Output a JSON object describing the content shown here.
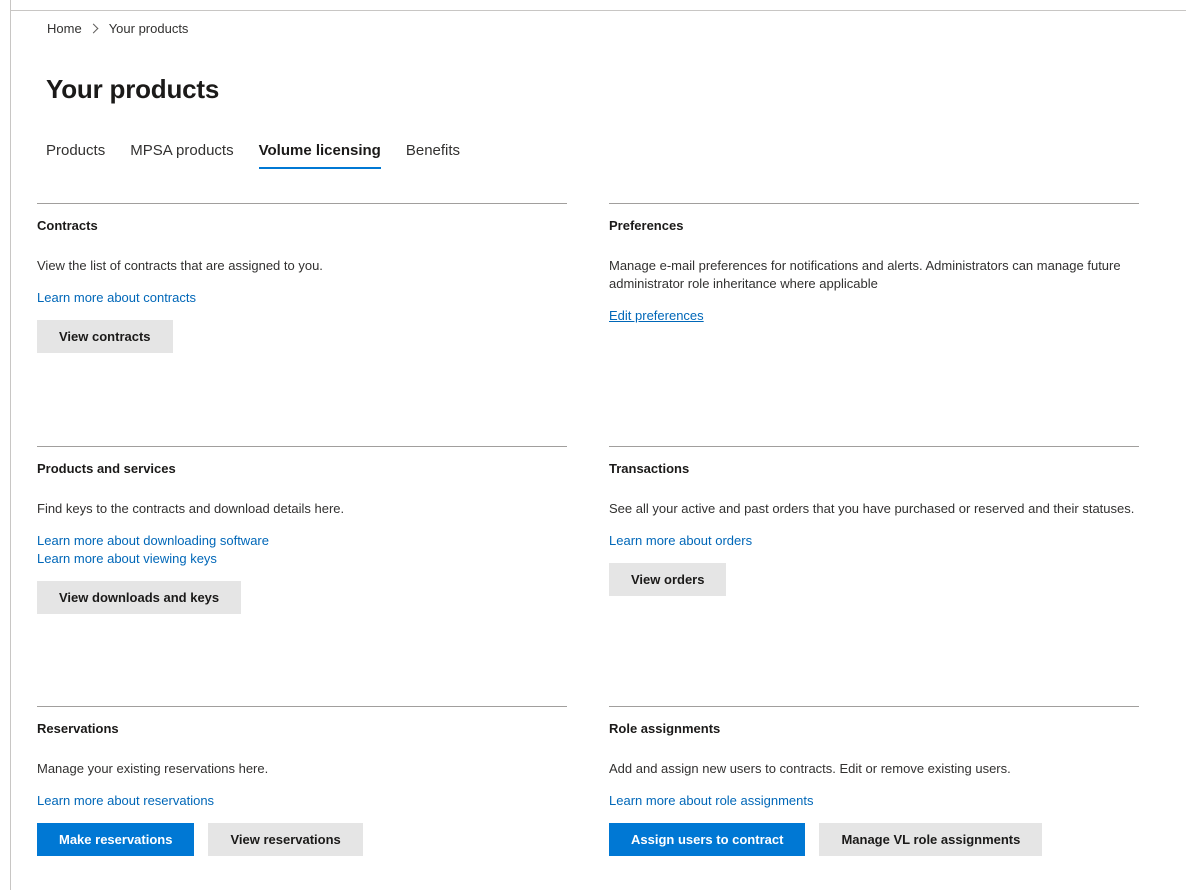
{
  "breadcrumb": {
    "home": "Home",
    "current": "Your products"
  },
  "page": {
    "title": "Your products"
  },
  "tabs": [
    {
      "label": "Products",
      "active": false
    },
    {
      "label": "MPSA products",
      "active": false
    },
    {
      "label": "Volume licensing",
      "active": true
    },
    {
      "label": "Benefits",
      "active": false
    }
  ],
  "cards": {
    "contracts": {
      "title": "Contracts",
      "description": "View the list of contracts that are assigned to you.",
      "links": [
        "Learn more about contracts"
      ],
      "buttons": [
        "View contracts"
      ]
    },
    "preferences": {
      "title": "Preferences",
      "description": "Manage e-mail preferences for notifications and alerts. Administrators can manage future administrator role inheritance where applicable",
      "links": [
        "Edit preferences"
      ],
      "buttons": []
    },
    "products_services": {
      "title": "Products and services",
      "description": "Find keys to the contracts and download details here.",
      "links": [
        "Learn more about downloading software",
        "Learn more about viewing keys"
      ],
      "buttons": [
        "View downloads and keys"
      ]
    },
    "transactions": {
      "title": "Transactions",
      "description": "See all your active and past orders that you have purchased or reserved and their statuses.",
      "links": [
        "Learn more about orders"
      ],
      "buttons": [
        "View orders"
      ]
    },
    "reservations": {
      "title": "Reservations",
      "description": "Manage your existing reservations here.",
      "links": [
        "Learn more about reservations"
      ],
      "buttons": [
        "Make reservations",
        "View reservations"
      ]
    },
    "role_assignments": {
      "title": "Role assignments",
      "description": "Add and assign new users to contracts. Edit or remove existing users.",
      "links": [
        "Learn more about role assignments"
      ],
      "buttons": [
        "Assign users to contract",
        "Manage VL role assignments"
      ]
    }
  },
  "colors": {
    "accent": "#0078d4",
    "link": "#0067b8",
    "secondary_button": "#e5e5e5"
  }
}
